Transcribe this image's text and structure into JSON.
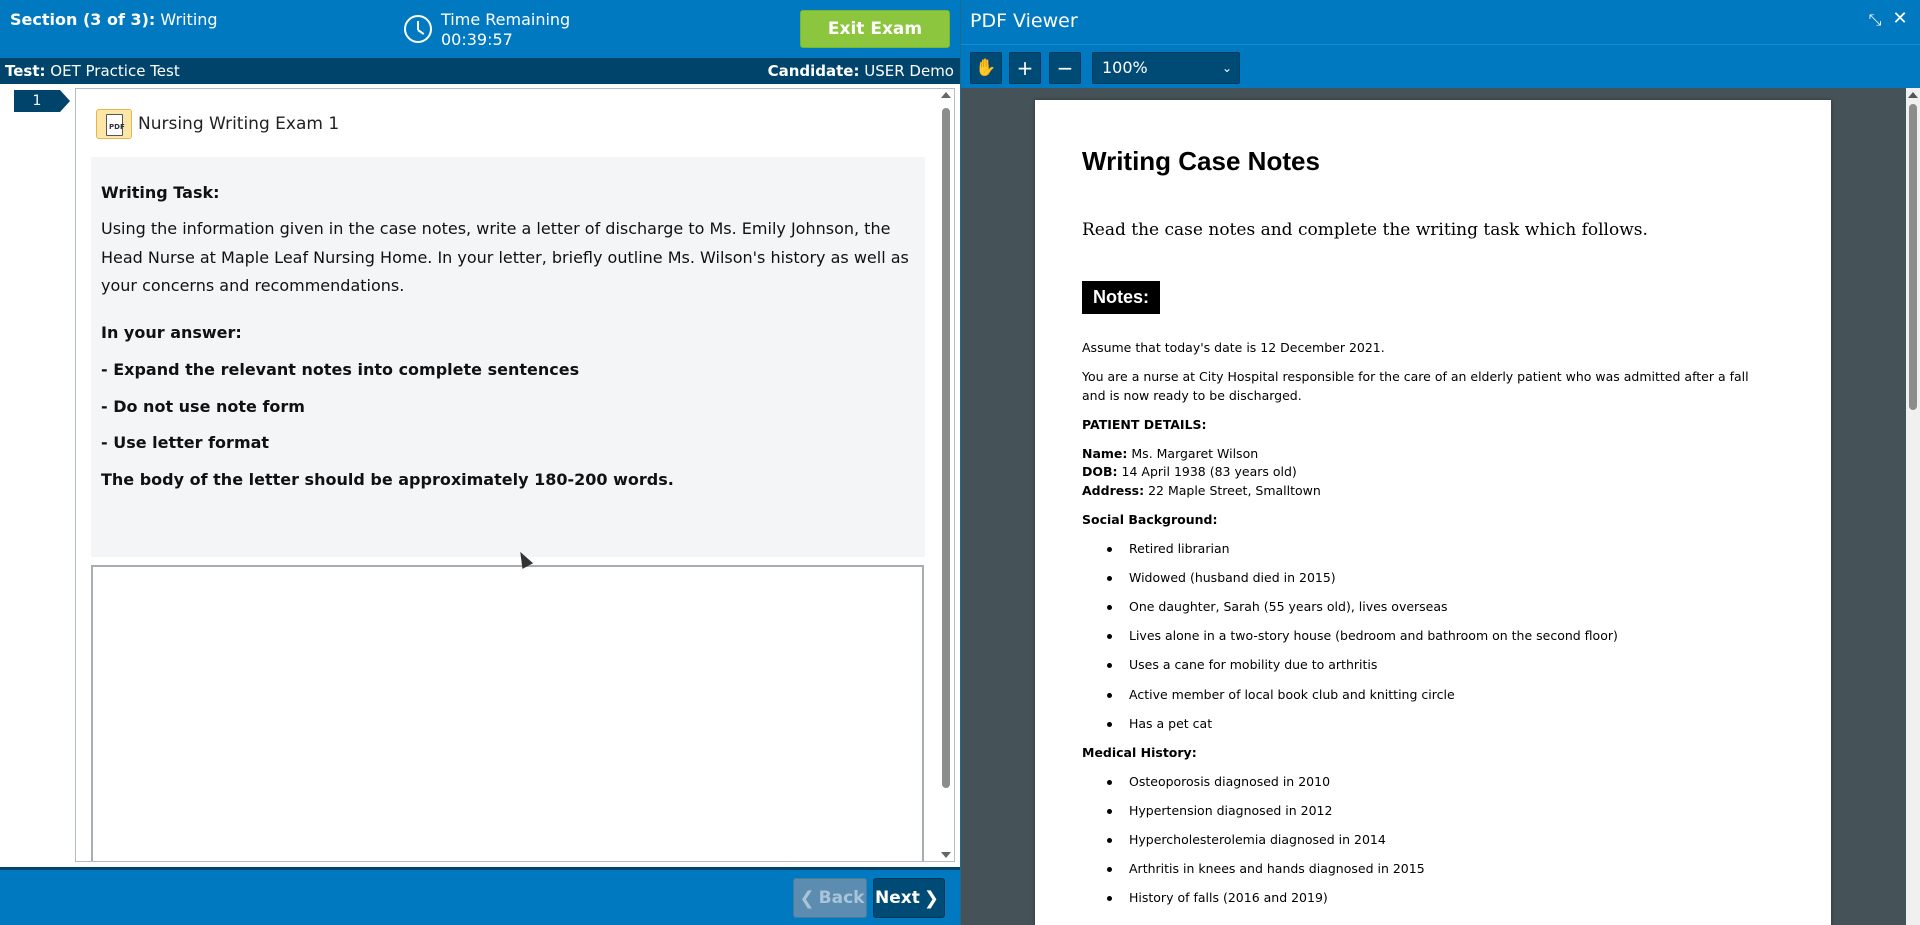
{
  "exam": {
    "section_prefix": "Section (3 of 3):",
    "section_name": "Writing",
    "time_label": "Time Remaining",
    "time_value": "00:39:57",
    "exit_label": "Exit Exam",
    "test_label": "Test:",
    "test_name": "OET Practice Test",
    "candidate_label": "Candidate:",
    "candidate_name": "USER Demo",
    "question_number": "1",
    "document_title": "Nursing Writing Exam 1",
    "task": {
      "heading": "Writing Task:",
      "intro": "Using the information given in the case notes, write a letter of discharge to Ms. Emily Johnson, the Head Nurse at Maple Leaf Nursing Home. In your letter, briefly outline Ms. Wilson's history as well as your concerns and recommendations.",
      "answer_heading": "In your answer:",
      "instructions": [
        "- Expand the relevant notes into complete sentences",
        "- Do not use note form",
        "- Use letter format"
      ],
      "word_count": "The body of the letter should be approximately 180-200 words."
    },
    "answer_value": "",
    "back_label": "Back",
    "next_label": "Next"
  },
  "pdf_viewer": {
    "title": "PDF Viewer",
    "zoom": "100%",
    "page": {
      "heading": "Writing Case Notes",
      "intro": "Read the case notes and complete the writing task which follows.",
      "notes_label": "Notes:",
      "date_line": "Assume that today's date is 12 December 2021.",
      "context_line": "You are a nurse at City Hospital responsible for the care of an elderly patient who was admitted after a fall and is now ready to be discharged.",
      "patient_details_heading": "PATIENT DETAILS:",
      "patient": {
        "name_label": "Name:",
        "name": "Ms. Margaret Wilson",
        "dob_label": "DOB:",
        "dob": "14 April 1938 (83 years old)",
        "address_label": "Address:",
        "address": "22 Maple Street, Smalltown"
      },
      "social_heading": "Social Background:",
      "social_items": [
        "Retired librarian",
        "Widowed (husband died in 2015)",
        "One daughter, Sarah (55 years old), lives overseas",
        "Lives alone in a two-story house (bedroom and bathroom on the second floor)",
        "Uses a cane for mobility due to arthritis",
        "Active member of local book club and knitting circle",
        "Has a pet cat"
      ],
      "medical_heading": "Medical History:",
      "medical_items": [
        "Osteoporosis diagnosed in 2010",
        "Hypertension diagnosed in 2012",
        "Hypercholesterolemia diagnosed in 2014",
        "Arthritis in knees and hands diagnosed in 2015",
        "History of falls (2016 and 2019)"
      ]
    }
  },
  "colors": {
    "header_blue": "#0079c1",
    "dark_blue": "#00446b",
    "exit_green": "#8cc63f",
    "viewer_background": "#455358"
  },
  "icons": [
    "clock-icon",
    "pdf-doc-icon",
    "hand-icon",
    "plus-icon",
    "minus-icon",
    "collapse-icon",
    "close-icon",
    "chevron-left-icon",
    "chevron-right-icon",
    "chevron-down-icon"
  ]
}
